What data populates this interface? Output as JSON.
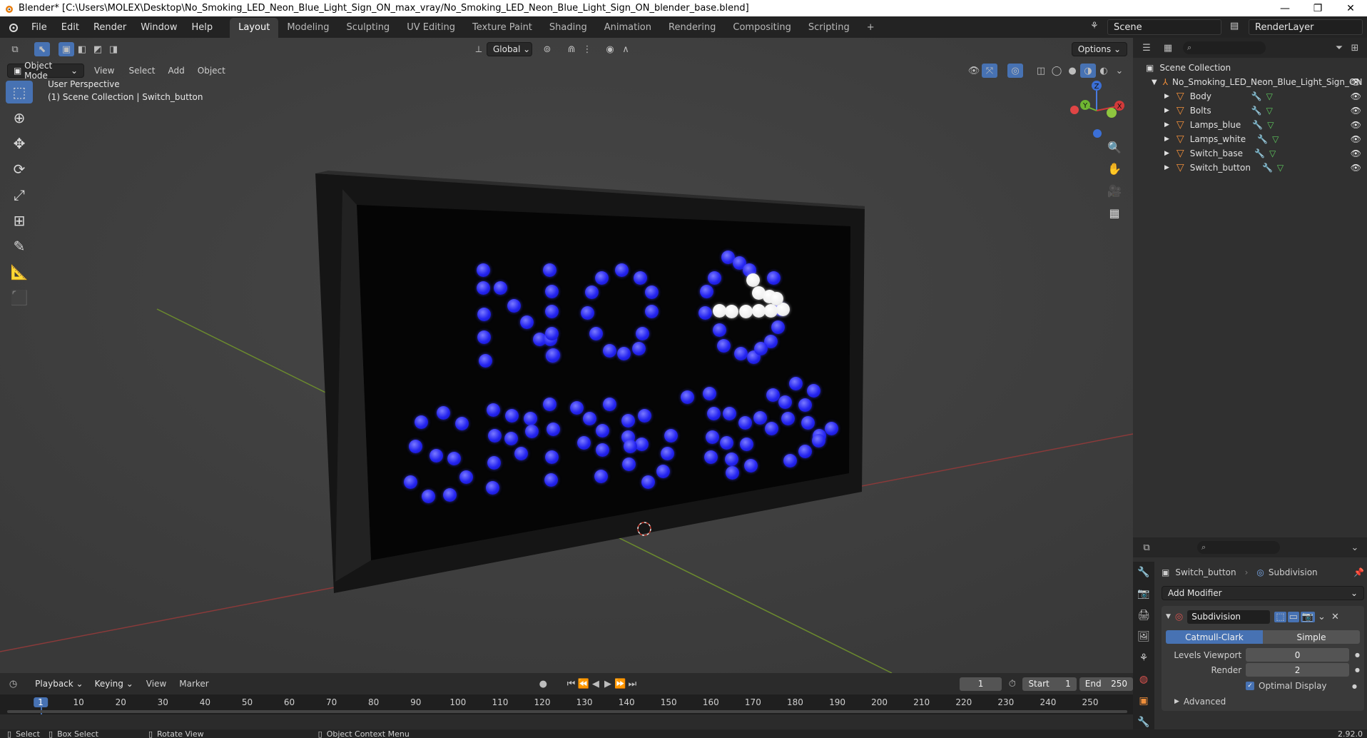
{
  "window": {
    "title": "Blender* [C:\\Users\\MOLEX\\Desktop\\No_Smoking_LED_Neon_Blue_Light_Sign_ON_max_vray/No_Smoking_LED_Neon_Blue_Light_Sign_ON_blender_base.blend]",
    "min": "—",
    "max": "❐",
    "close": "✕"
  },
  "menu": {
    "file": "File",
    "edit": "Edit",
    "render": "Render",
    "window": "Window",
    "help": "Help"
  },
  "workspaces": [
    "Layout",
    "Modeling",
    "Sculpting",
    "UV Editing",
    "Texture Paint",
    "Shading",
    "Animation",
    "Rendering",
    "Compositing",
    "Scripting"
  ],
  "workspace_add": "+",
  "scene": {
    "name": "Scene",
    "layer": "RenderLayer"
  },
  "viewport": {
    "mode": "Object Mode",
    "menus": [
      "View",
      "Select",
      "Add",
      "Object"
    ],
    "transform": "Global",
    "options": "Options",
    "overlay_line1": "User Perspective",
    "overlay_line2": "(1) Scene Collection | Switch_button",
    "gizmo": {
      "x": "X",
      "y": "Y",
      "z": "Z"
    }
  },
  "outliner": {
    "root": "Scene Collection",
    "object": "No_Smoking_LED_Neon_Blue_Light_Sign_ON",
    "children": [
      "Body",
      "Bolts",
      "Lamps_blue",
      "Lamps_white",
      "Switch_base",
      "Switch_button"
    ]
  },
  "properties": {
    "object_name": "Switch_button",
    "modifier_tab": "Subdivision",
    "add_modifier": "Add Modifier",
    "modifier_name": "Subdivision",
    "type_catmull": "Catmull-Clark",
    "type_simple": "Simple",
    "levels_viewport_label": "Levels Viewport",
    "levels_viewport": "0",
    "render_label": "Render",
    "render_value": "2",
    "optimal_display": "Optimal Display",
    "advanced": "Advanced"
  },
  "timeline": {
    "menus": [
      "Playback",
      "Keying",
      "View",
      "Marker"
    ],
    "current_frame": "1",
    "start_label": "Start",
    "start": "1",
    "end_label": "End",
    "end": "250",
    "ticks": [
      "1",
      "10",
      "20",
      "30",
      "40",
      "50",
      "60",
      "70",
      "80",
      "90",
      "100",
      "110",
      "120",
      "130",
      "140",
      "150",
      "160",
      "170",
      "180",
      "190",
      "200",
      "210",
      "220",
      "230",
      "240",
      "250"
    ]
  },
  "status": {
    "select": "Select",
    "box_select": "Box Select",
    "rotate": "Rotate View",
    "context": "Object Context Menu",
    "version": "2.92.0"
  },
  "colors": {
    "accent": "#4772b3",
    "object": "#ef8e3a",
    "led": "#2424f0"
  }
}
